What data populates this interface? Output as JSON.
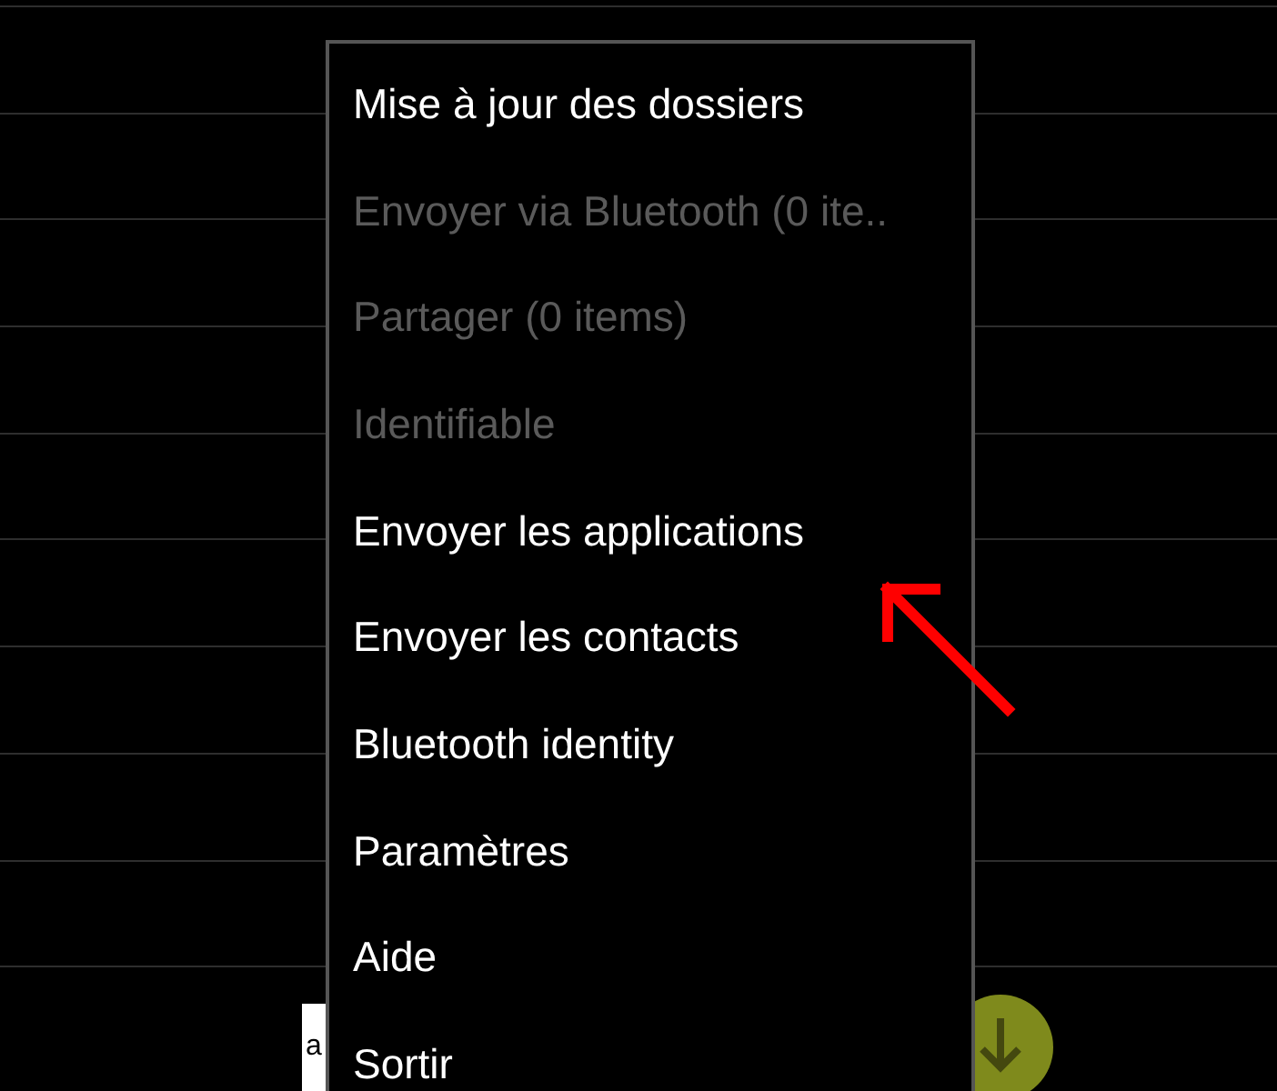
{
  "menu": {
    "items": [
      {
        "label": "Mise à jour des dossiers",
        "disabled": false
      },
      {
        "label": "Envoyer via Bluetooth (0 ite..",
        "disabled": true
      },
      {
        "label": "Partager (0 items)",
        "disabled": true
      },
      {
        "label": "Identifiable",
        "disabled": true
      },
      {
        "label": "Envoyer les applications",
        "disabled": false
      },
      {
        "label": "Envoyer les contacts",
        "disabled": false
      },
      {
        "label": "Bluetooth identity",
        "disabled": false
      },
      {
        "label": "Paramètres",
        "disabled": false
      },
      {
        "label": "Aide",
        "disabled": false
      },
      {
        "label": "Sortir",
        "disabled": false
      }
    ]
  },
  "ad_banner": {
    "logo": "a"
  }
}
